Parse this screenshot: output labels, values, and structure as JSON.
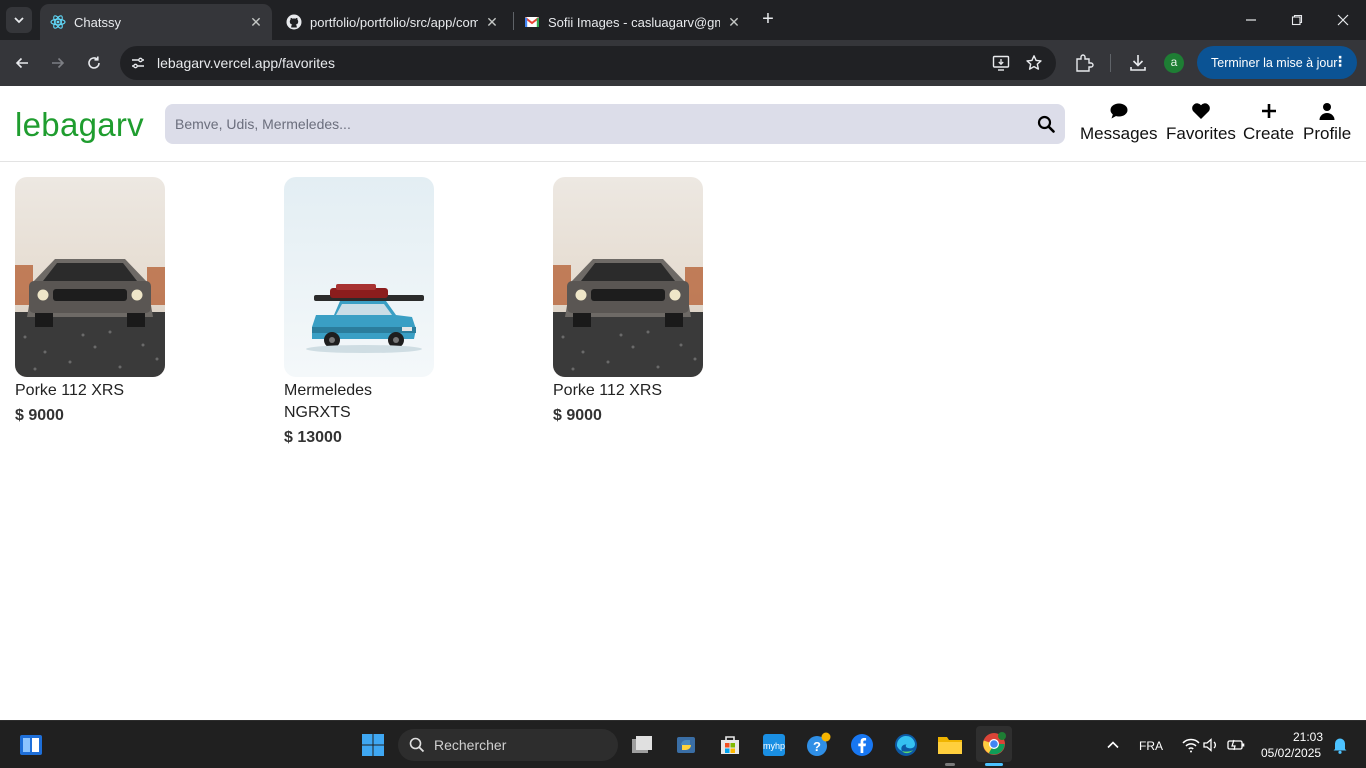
{
  "browser": {
    "tabs": [
      {
        "title": "Chatssy",
        "active": true
      },
      {
        "title": "portfolio/portfolio/src/app/com",
        "active": false
      },
      {
        "title": "Sofii Images - casluagarv@gma",
        "active": false
      }
    ],
    "url": "lebagarv.vercel.app/favorites",
    "profile_initial": "a",
    "update_label": "Terminer la mise à jour"
  },
  "site": {
    "logo": "lebagarv",
    "search_placeholder": "Bemve, Udis, Mermeledes...",
    "nav": [
      {
        "label": "Messages",
        "icon": "message-icon"
      },
      {
        "label": "Favorites",
        "icon": "heart-icon"
      },
      {
        "label": "Create",
        "icon": "plus-icon"
      },
      {
        "label": "Profile",
        "icon": "user-icon"
      }
    ]
  },
  "favorites": [
    {
      "name": "Porke 112 XRS",
      "price": "$ 9000",
      "image": "gray-muscle-car"
    },
    {
      "name": "Mermeledes NGRXTS",
      "price": "$ 13000",
      "image": "blue-car-in-snow"
    },
    {
      "name": "Porke 112 XRS",
      "price": "$ 9000",
      "image": "gray-muscle-car"
    }
  ],
  "taskbar": {
    "search_label": "Rechercher",
    "language": "FRA",
    "time": "21:03",
    "date": "05/02/2025"
  },
  "colors": {
    "logo": "#1f9d2f",
    "search_bg": "#dcdde9",
    "update_button": "#0b5394"
  }
}
